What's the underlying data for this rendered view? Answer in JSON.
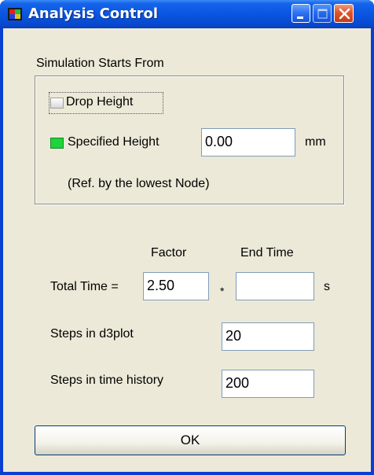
{
  "window": {
    "title": "Analysis Control"
  },
  "simulation": {
    "group_label": "Simulation Starts From",
    "drop_height": {
      "label": "Drop Height",
      "checked": false
    },
    "specified_height": {
      "label": "Specified Height",
      "checked": true,
      "value": "0.00",
      "unit": "mm"
    },
    "note": "(Ref. by the lowest Node)"
  },
  "timing": {
    "factor_header": "Factor",
    "end_time_header": "End Time",
    "total_time_label": "Total Time =",
    "factor_value": "2.50",
    "multiply_sign": "*",
    "end_time_value": "",
    "unit": "s",
    "d3plot_label": "Steps in d3plot",
    "d3plot_value": "20",
    "history_label": "Steps in time history",
    "history_value": "200"
  },
  "buttons": {
    "ok_label": "OK"
  },
  "colors": {
    "titlebar": "#0a55e0",
    "checked_box": "#1fd33a",
    "client_bg": "#ece9d8"
  }
}
